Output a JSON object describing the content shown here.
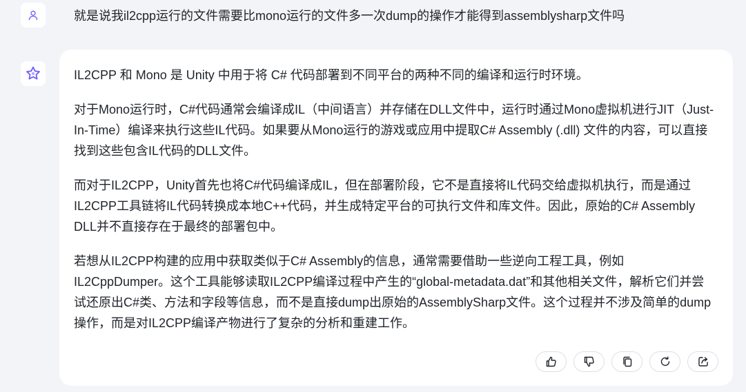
{
  "user_message": {
    "text": "就是说我il2cpp运行的文件需要比mono运行的文件多一次dump的操作才能得到assemblysharp文件吗",
    "avatar_icon": "person-icon"
  },
  "assistant_message": {
    "avatar_icon": "kimi-logo-icon",
    "paragraphs": [
      "IL2CPP 和 Mono 是 Unity 中用于将 C# 代码部署到不同平台的两种不同的编译和运行时环境。",
      "对于Mono运行时，C#代码通常会编译成IL（中间语言）并存储在DLL文件中，运行时通过Mono虚拟机进行JIT（Just-In-Time）编译来执行这些IL代码。如果要从Mono运行的游戏或应用中提取C# Assembly (.dll) 文件的内容，可以直接找到这些包含IL代码的DLL文件。",
      "而对于IL2CPP，Unity首先也将C#代码编译成IL，但在部署阶段，它不是直接将IL代码交给虚拟机执行，而是通过IL2CPP工具链将IL代码转换成本地C++代码，并生成特定平台的可执行文件和库文件。因此，原始的C# Assembly DLL并不直接存在于最终的部署包中。",
      "若想从IL2CPP构建的应用中获取类似于C# Assembly的信息，通常需要借助一些逆向工程工具，例如IL2CppDumper。这个工具能够读取IL2CPP编译过程中产生的“global-metadata.dat”和其他相关文件，解析它们并尝试还原出C#类、方法和字段等信息，而不是直接dump出原始的AssemblySharp文件。这个过程并不涉及简单的dump操作，而是对IL2CPP编译产物进行了复杂的分析和重建工作。"
    ],
    "actions": [
      "thumbs-up-icon",
      "thumbs-down-icon",
      "copy-icon",
      "regenerate-icon",
      "share-icon"
    ]
  },
  "colors": {
    "background": "#f3f4f8",
    "bubble": "#ffffff",
    "text": "#1f2329",
    "accent": "#6b5bff"
  }
}
